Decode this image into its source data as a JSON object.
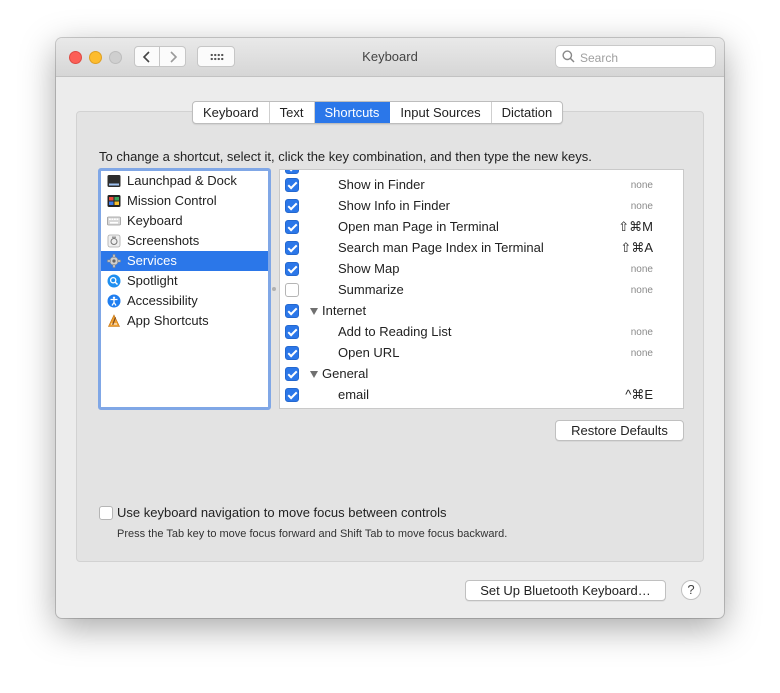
{
  "window": {
    "title": "Keyboard",
    "search_placeholder": "Search"
  },
  "tabs": [
    {
      "label": "Keyboard",
      "selected": false
    },
    {
      "label": "Text",
      "selected": false
    },
    {
      "label": "Shortcuts",
      "selected": true
    },
    {
      "label": "Input Sources",
      "selected": false
    },
    {
      "label": "Dictation",
      "selected": false
    }
  ],
  "instruction": "To change a shortcut, select it, click the key combination, and then type the new keys.",
  "categories": [
    {
      "label": "Launchpad & Dock",
      "icon": "launchpad-dock-icon"
    },
    {
      "label": "Mission Control",
      "icon": "mission-control-icon"
    },
    {
      "label": "Keyboard",
      "icon": "keyboard-icon"
    },
    {
      "label": "Screenshots",
      "icon": "screenshots-icon"
    },
    {
      "label": "Services",
      "icon": "gear-icon",
      "selected": true
    },
    {
      "label": "Spotlight",
      "icon": "spotlight-icon"
    },
    {
      "label": "Accessibility",
      "icon": "accessibility-icon"
    },
    {
      "label": "App Shortcuts",
      "icon": "app-shortcuts-icon"
    }
  ],
  "shortcuts": [
    {
      "label": "Show in Finder",
      "checked": true,
      "key": "none"
    },
    {
      "label": "Show Info in Finder",
      "checked": true,
      "key": "none"
    },
    {
      "label": "Open man Page in Terminal",
      "checked": true,
      "key": "⇧⌘M"
    },
    {
      "label": "Search man Page Index in Terminal",
      "checked": true,
      "key": "⇧⌘A"
    },
    {
      "label": "Show Map",
      "checked": true,
      "key": "none"
    },
    {
      "label": "Summarize",
      "checked": false,
      "key": "none"
    },
    {
      "label": "Internet",
      "checked": true,
      "group": true
    },
    {
      "label": "Add to Reading List",
      "checked": true,
      "key": "none"
    },
    {
      "label": "Open URL",
      "checked": true,
      "key": "none"
    },
    {
      "label": "General",
      "checked": true,
      "group": true
    },
    {
      "label": "email",
      "checked": true,
      "key": "^⌘E"
    }
  ],
  "buttons": {
    "restore_defaults": "Restore Defaults",
    "bluetooth_keyboard": "Set Up Bluetooth Keyboard…",
    "help": "?"
  },
  "keyboard_navigation": {
    "label": "Use keyboard navigation to move focus between controls",
    "checked": false,
    "hint": "Press the Tab key to move focus forward and Shift Tab to move focus backward."
  },
  "colors": {
    "accent": "#2b77e9"
  }
}
